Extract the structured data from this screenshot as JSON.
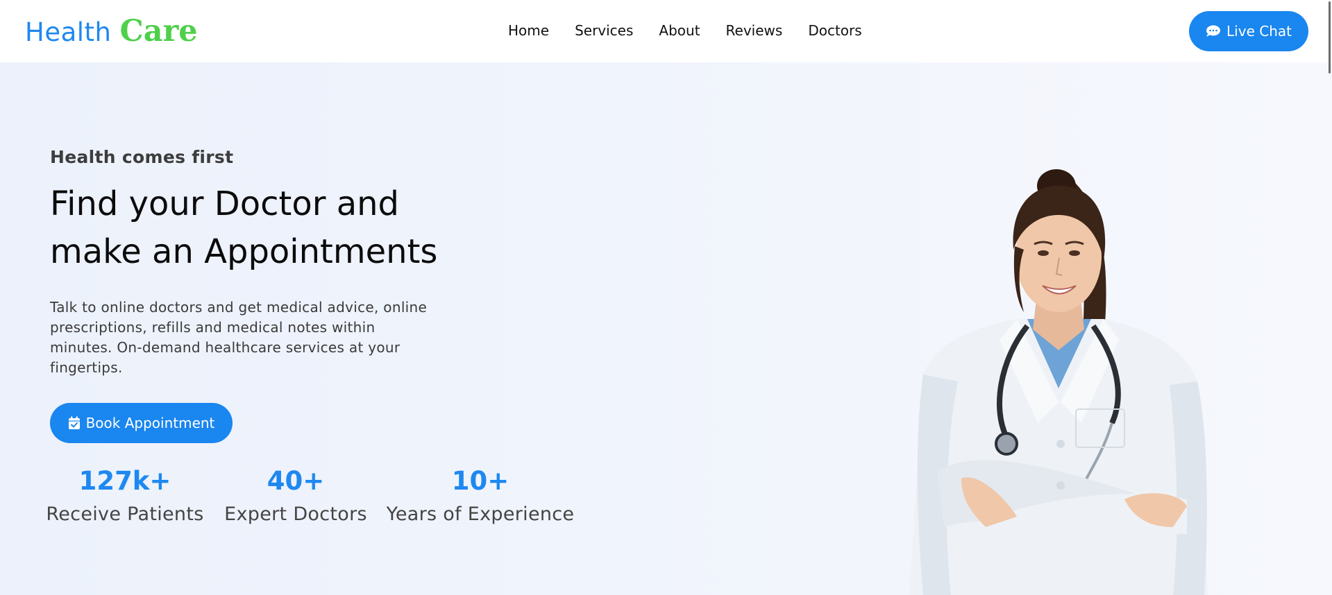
{
  "brand": {
    "word1": "Health",
    "word2": "Care",
    "color1": "#1e88f0",
    "color2": "#4ed04b"
  },
  "nav": {
    "links": [
      "Home",
      "Services",
      "About",
      "Reviews",
      "Doctors"
    ],
    "live_chat": {
      "label": "Live Chat",
      "icon": "chat-bubble-icon"
    }
  },
  "hero": {
    "eyebrow": "Health comes first",
    "headline_line1": "Find your Doctor and",
    "headline_line2": "make an Appointments",
    "description": "Talk to online doctors and get medical advice, online prescriptions, refills and medical notes within minutes. On-demand healthcare services at your fingertips.",
    "cta": {
      "label": "Book Appointment",
      "icon": "calendar-check-icon"
    },
    "stats": [
      {
        "value": "127k+",
        "label": "Receive Patients"
      },
      {
        "value": "40+",
        "label": "Expert Doctors"
      },
      {
        "value": "10+",
        "label": "Years of Experience"
      }
    ],
    "image_subject": "smiling-female-doctor"
  },
  "colors": {
    "accent": "#1a86ef",
    "hero_bg": "#eef3fc"
  }
}
